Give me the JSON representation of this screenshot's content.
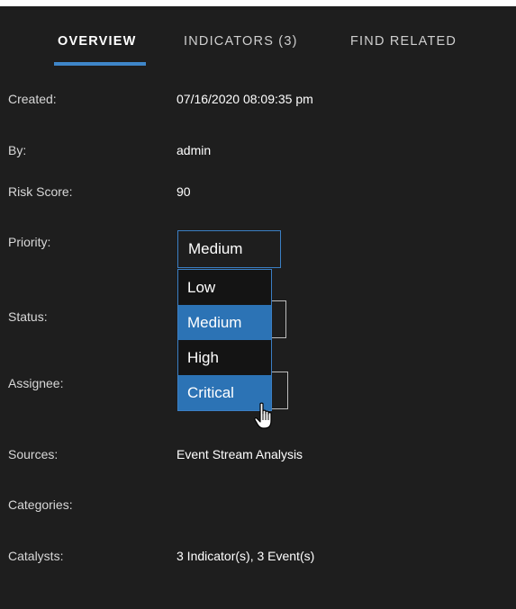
{
  "tabs": [
    {
      "label": "OVERVIEW",
      "active": true
    },
    {
      "label": "INDICATORS (3)",
      "active": false
    },
    {
      "label": "FIND RELATED",
      "active": false
    }
  ],
  "fields": {
    "created": {
      "label": "Created:",
      "value": "07/16/2020 08:09:35 pm"
    },
    "by": {
      "label": "By:",
      "value": "admin"
    },
    "risk_score": {
      "label": "Risk Score:",
      "value": "90"
    },
    "priority": {
      "label": "Priority:",
      "value": "Medium"
    },
    "status": {
      "label": "Status:"
    },
    "assignee": {
      "label": "Assignee:"
    },
    "sources": {
      "label": "Sources:",
      "value": "Event Stream Analysis"
    },
    "categories": {
      "label": "Categories:"
    },
    "catalysts": {
      "label": "Catalysts:",
      "value": "3 Indicator(s), 3 Event(s)"
    }
  },
  "priority_options": [
    "Low",
    "Medium",
    "High",
    "Critical"
  ],
  "priority_selected": "Medium",
  "priority_hovered": "Critical",
  "colors": {
    "panel_bg": "#1e1e1e",
    "accent": "#3f86c9",
    "selected_option": "#2c73b5"
  },
  "icons": {
    "cursor": "hand-pointer-icon"
  }
}
